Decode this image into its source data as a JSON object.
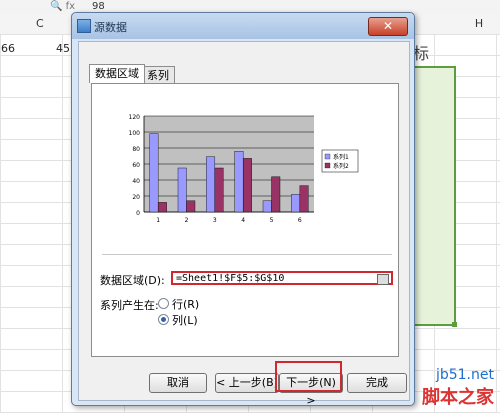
{
  "sheet": {
    "formula_icons": "🔍 fx",
    "formula_value": "98",
    "column_headers": [
      "C",
      "H"
    ],
    "cell_left_values": [
      "66",
      "45"
    ],
    "cell_right_text": "标"
  },
  "dialog": {
    "title": "源数据",
    "close_symbol": "✕",
    "tabs": [
      "数据区域",
      "系列"
    ],
    "data_range_label": "数据区域(D):",
    "data_range_value": "=Sheet1!$F$5:$G$10",
    "series_in_label": "系列产生在:",
    "radio_row_label": "行(R)",
    "radio_col_label": "列(L)",
    "selected_series_in": "列",
    "buttons": {
      "cancel": "取消",
      "back": "< 上一步(B)",
      "next": "下一步(N) >",
      "finish": "完成"
    }
  },
  "chart_data": {
    "type": "bar",
    "categories": [
      "1",
      "2",
      "3",
      "4",
      "5",
      "6"
    ],
    "series": [
      {
        "name": "系列1",
        "values": [
          98,
          55,
          69,
          76,
          14,
          22
        ],
        "color": "#9999ff"
      },
      {
        "name": "系列2",
        "values": [
          12,
          14,
          55,
          67,
          44,
          33
        ],
        "color": "#993366"
      }
    ],
    "yticks": [
      "0",
      "20",
      "40",
      "60",
      "80",
      "100",
      "120"
    ],
    "ylim": [
      0,
      120
    ],
    "grid": true,
    "legend": "right",
    "plot_bg": "#c0c0c0"
  },
  "watermark": {
    "line1": "jb51.net",
    "line2": "脚本之家"
  }
}
